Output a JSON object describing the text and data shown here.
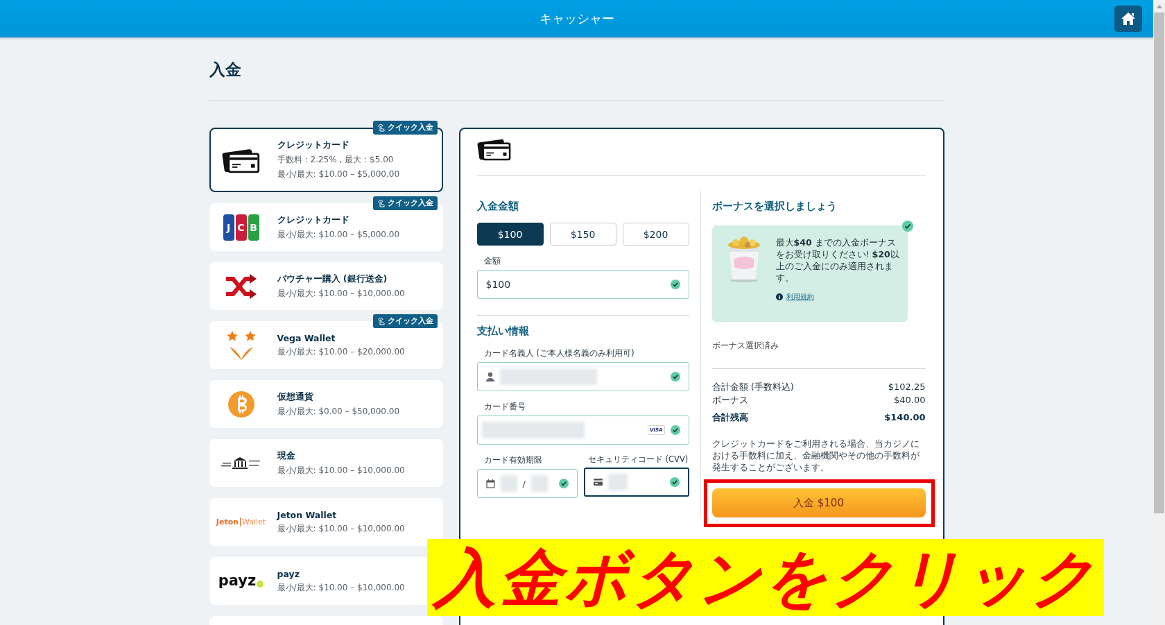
{
  "header": {
    "title": "キャッシャー"
  },
  "page_title": "入金",
  "methods": [
    {
      "kind": "card",
      "name": "クレジットカード",
      "fee": "手数料：2.25% , 最大：$5.00",
      "limits": "最小/最大: $10.00 – $5,000.00",
      "quick": "クイック入金",
      "selected": true
    },
    {
      "kind": "jcb",
      "logo_text": [
        "J",
        "C",
        "B"
      ],
      "name": "クレジットカード",
      "limits": "最小/最大: $10.00 – $5,000.00",
      "quick": "クイック入金",
      "selected": false
    },
    {
      "kind": "shuffle",
      "name": "バウチャー購入 (銀行送金)",
      "limits": "最小/最大: $10.00 – $10,000.00",
      "selected": false
    },
    {
      "kind": "vega",
      "name": "Vega Wallet",
      "limits": "最小/最大: $10.00 – $20,000.00",
      "quick": "クイック入金",
      "selected": false
    },
    {
      "kind": "bitcoin",
      "name": "仮想通貨",
      "limits": "最小/最大: $0.00 – $50,000.00",
      "selected": false
    },
    {
      "kind": "bank",
      "name": "現金",
      "limits": "最小/最大: $10.00 – $10,000.00",
      "selected": false
    },
    {
      "kind": "jeton",
      "logo_text": [
        "Jeton",
        "Wallet"
      ],
      "name": "Jeton Wallet",
      "limits": "最小/最大: $10.00 – $10,000.00",
      "selected": false
    },
    {
      "kind": "payz",
      "logo_text": [
        "payz"
      ],
      "name": "payz",
      "limits": "最小/最大: $10.00 – $10,000.00",
      "selected": false
    },
    {
      "kind": "blank",
      "selected": false
    }
  ],
  "deposit": {
    "amount_heading": "入金金額",
    "presets": [
      {
        "label": "$100",
        "selected": true
      },
      {
        "label": "$150",
        "selected": false
      },
      {
        "label": "$200",
        "selected": false
      }
    ],
    "amount": {
      "label": "金額",
      "value": "$100",
      "valid": true
    },
    "payment_heading": "支払い情報",
    "holder": {
      "label": "カード名義人 (ご本人様名義のみ利用可)",
      "masked": true,
      "valid": true
    },
    "number": {
      "label": "カード番号",
      "brand": "VISA",
      "masked": true,
      "valid": true
    },
    "expiry": {
      "label": "カード有効期限",
      "separator": "/",
      "masked": true,
      "valid": true
    },
    "cvv": {
      "label": "セキュリティコード (CVV)",
      "masked": true,
      "valid": true,
      "focused": true
    }
  },
  "bonus": {
    "heading": "ボーナスを選択しましょう",
    "offer": {
      "kind": "picture",
      "selected": true,
      "text": "最大**$40** までの入金ボーナスをお受け取りください! **$20**以上のご入金にのみ適用されます。",
      "terms_link": "利用規約"
    },
    "status": "ボーナス選択済み",
    "summary": [
      {
        "label": "合計金額 (手数料込)",
        "value": "$102.25",
        "bold": false
      },
      {
        "label": "ボーナス",
        "value": "$40.00",
        "bold": false
      },
      {
        "label": "合計残高",
        "value": "$140.00",
        "bold": true
      }
    ],
    "note": "クレジットカードをご利用される場合、当カジノにおける手数料に加え、金融機関やその他の手数料が発生することがございます。",
    "submit": {
      "label": "入金 $100",
      "highlighted": true
    }
  },
  "annotation": {
    "caption": "入金ボタンをクリック"
  }
}
